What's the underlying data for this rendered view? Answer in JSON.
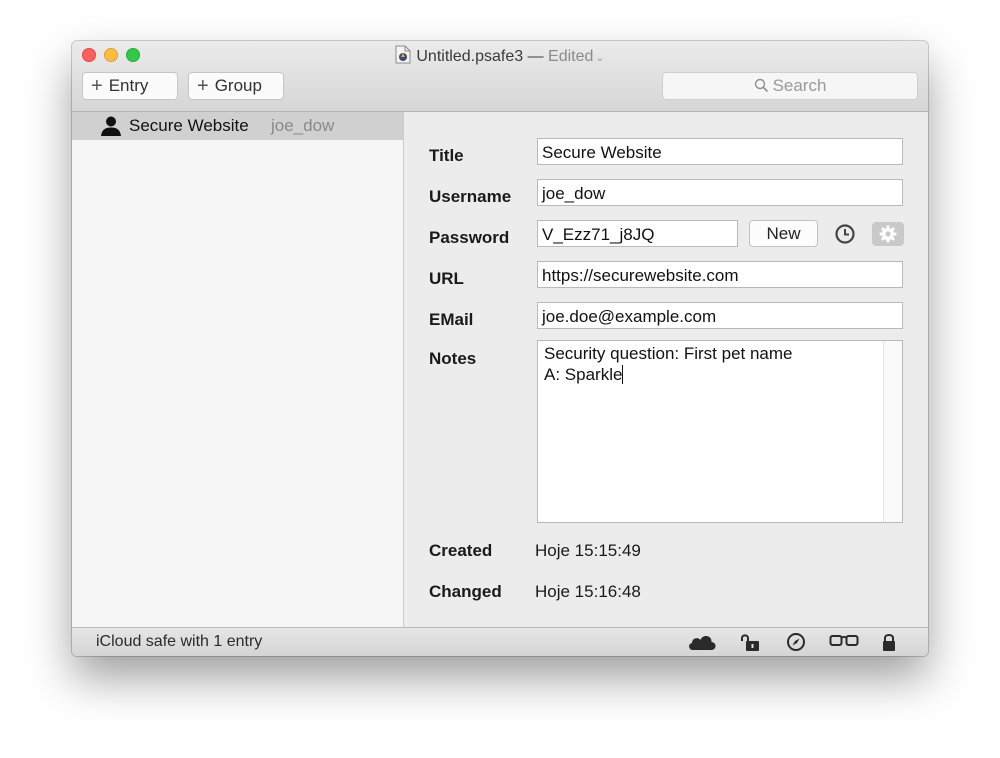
{
  "window": {
    "title": "Untitled.psafe3",
    "separator": "—",
    "edited_label": "Edited",
    "edited_chevron": "chevron-down-icon"
  },
  "toolbar": {
    "entry_label": "Entry",
    "group_label": "Group",
    "add_icon": "plus-icon",
    "search_placeholder": "Search"
  },
  "sidebar": {
    "items": [
      {
        "icon": "person-icon",
        "title": "Secure Website",
        "username": "joe_dow",
        "selected": true
      }
    ]
  },
  "detail": {
    "title_label": "Title",
    "title_value": "Secure Website",
    "username_label": "Username",
    "username_value": "joe_dow",
    "password_label": "Password",
    "password_value": "V_Ezz71_j8JQ",
    "new_button": "New",
    "url_label": "URL",
    "url_value": "https://securewebsite.com",
    "email_label": "EMail",
    "email_value": "joe.doe@example.com",
    "notes_label": "Notes",
    "notes_lines": [
      "Security question: First pet name",
      "A: Sparkle"
    ],
    "created_label": "Created",
    "created_value": "Hoje 15:15:49",
    "changed_label": "Changed",
    "changed_value": "Hoje 15:16:48"
  },
  "statusbar": {
    "text": "iCloud safe with 1 entry",
    "icons": [
      "cloud-icon",
      "unlock-icon",
      "compass-icon",
      "glasses-icon",
      "lock-icon"
    ]
  },
  "colors": {
    "close": "#fc605c",
    "minimize": "#fdbc40",
    "zoom": "#34c84a",
    "selection": "#d0d0d0"
  }
}
